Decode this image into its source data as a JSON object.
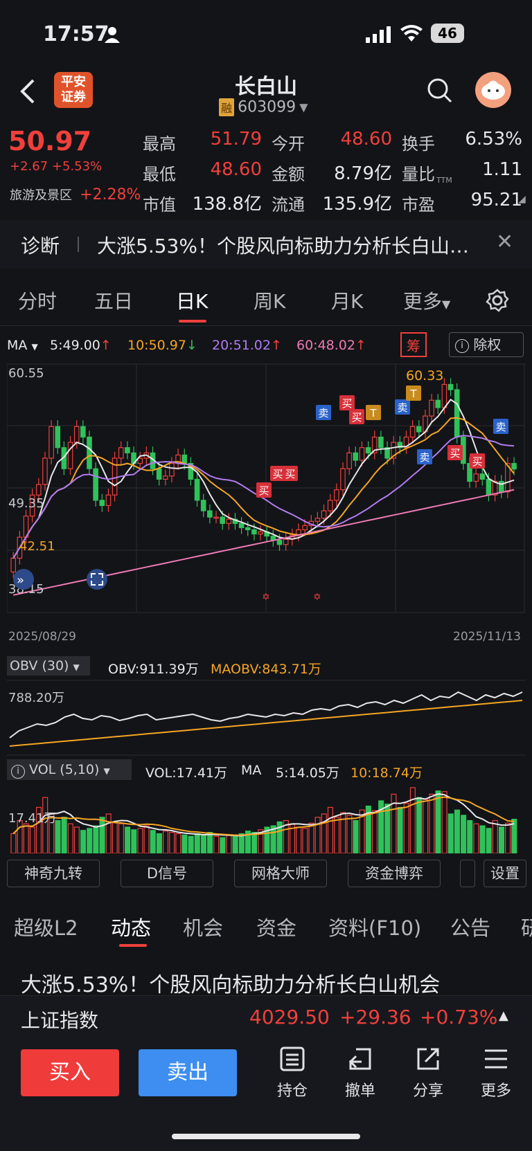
{
  "status": {
    "time": "17:57",
    "battery": "46"
  },
  "header": {
    "title": "长白山",
    "badge": "融",
    "code": "603099",
    "broker_logo_line1": "平安",
    "broker_logo_line2": "证券"
  },
  "quote": {
    "price": "50.97",
    "change": "+2.67",
    "change_pct": "+5.53%",
    "sector": "旅游及景区",
    "sector_pct": "+2.28%",
    "fields": [
      {
        "label": "最高",
        "value": "51.79",
        "color": "red"
      },
      {
        "label": "今开",
        "value": "48.60",
        "color": "red"
      },
      {
        "label": "换手",
        "value": "6.53%",
        "color": "white"
      },
      {
        "label": "最低",
        "value": "48.60",
        "color": "red"
      },
      {
        "label": "金额",
        "value": "8.79亿",
        "color": "white"
      },
      {
        "label": "量比",
        "value": "1.11",
        "color": "white"
      },
      {
        "label": "市值",
        "value": "138.8亿",
        "color": "white"
      },
      {
        "label": "流通",
        "value": "135.9亿",
        "color": "white"
      },
      {
        "label": "市盈",
        "value": "95.21",
        "color": "white"
      }
    ],
    "pe_suffix": "TTM"
  },
  "diag": {
    "label": "诊断",
    "text": "大涨5.53%！个股风向标助力分析长白山…"
  },
  "ktabs": {
    "items": [
      "分时",
      "五日",
      "日K",
      "周K",
      "月K",
      "更多"
    ],
    "active": 2
  },
  "ma": {
    "label": "MA",
    "ma5": "5:49.00",
    "ma10": "10:50.97",
    "ma20": "20:51.02",
    "ma60": "60:48.02",
    "chip": "筹",
    "adjust": "除权"
  },
  "kchart": {
    "y_top": "60.55",
    "y_mid": "49.35",
    "y_low": "42.51",
    "y_bottom": "38.15",
    "high_label": "60.33",
    "date_start": "2025/08/29",
    "date_end": "2025/11/13",
    "markers": [
      {
        "text": "买",
        "kind": "buy"
      },
      {
        "text": "买",
        "kind": "buy"
      },
      {
        "text": "买",
        "kind": "buy"
      },
      {
        "text": "卖",
        "kind": "sell"
      },
      {
        "text": "买",
        "kind": "buy"
      },
      {
        "text": "买",
        "kind": "buy"
      },
      {
        "text": "T",
        "kind": "t"
      },
      {
        "text": "卖",
        "kind": "sell"
      },
      {
        "text": "T",
        "kind": "t"
      },
      {
        "text": "卖",
        "kind": "sell"
      },
      {
        "text": "买",
        "kind": "buy"
      },
      {
        "text": "买",
        "kind": "buy"
      },
      {
        "text": "卖",
        "kind": "sell"
      }
    ]
  },
  "obv": {
    "selector": "OBV (30)",
    "obv": "OBV:911.39万",
    "maobv": "MAOBV:843.71万",
    "axis": "788.20万"
  },
  "vol": {
    "selector": "VOL (5,10)",
    "vol": "VOL:17.41万",
    "ma_label": "MA",
    "ma5": "5:14.05万",
    "ma10": "10:18.74万",
    "axis": "17.41万"
  },
  "indicators": [
    "神奇九转",
    "D信号",
    "网格大师",
    "资金博弈",
    "设置"
  ],
  "ctabs": {
    "items": [
      "超级L2",
      "动态",
      "机会",
      "资金",
      "资料(F10)",
      "公告",
      "研"
    ],
    "active": 1
  },
  "news": {
    "headline": "大涨5.53%！个股风向标助力分析长白山机会"
  },
  "index": {
    "name": "上证指数",
    "value": "4029.50",
    "change": "+29.36",
    "pct": "+0.73%"
  },
  "bottom": {
    "buy": "买入",
    "sell": "卖出",
    "tools": [
      "持仓",
      "撤单",
      "分享",
      "更多"
    ]
  },
  "colors": {
    "up": "#f0403c",
    "down": "#2fc25b",
    "buy_btn": "#f03b3b",
    "sell_btn": "#3d8ef0",
    "ma5": "#e8e8ea",
    "ma10": "#f5a623",
    "ma20": "#b27cf0",
    "ma60": "#ee7ab5"
  }
}
